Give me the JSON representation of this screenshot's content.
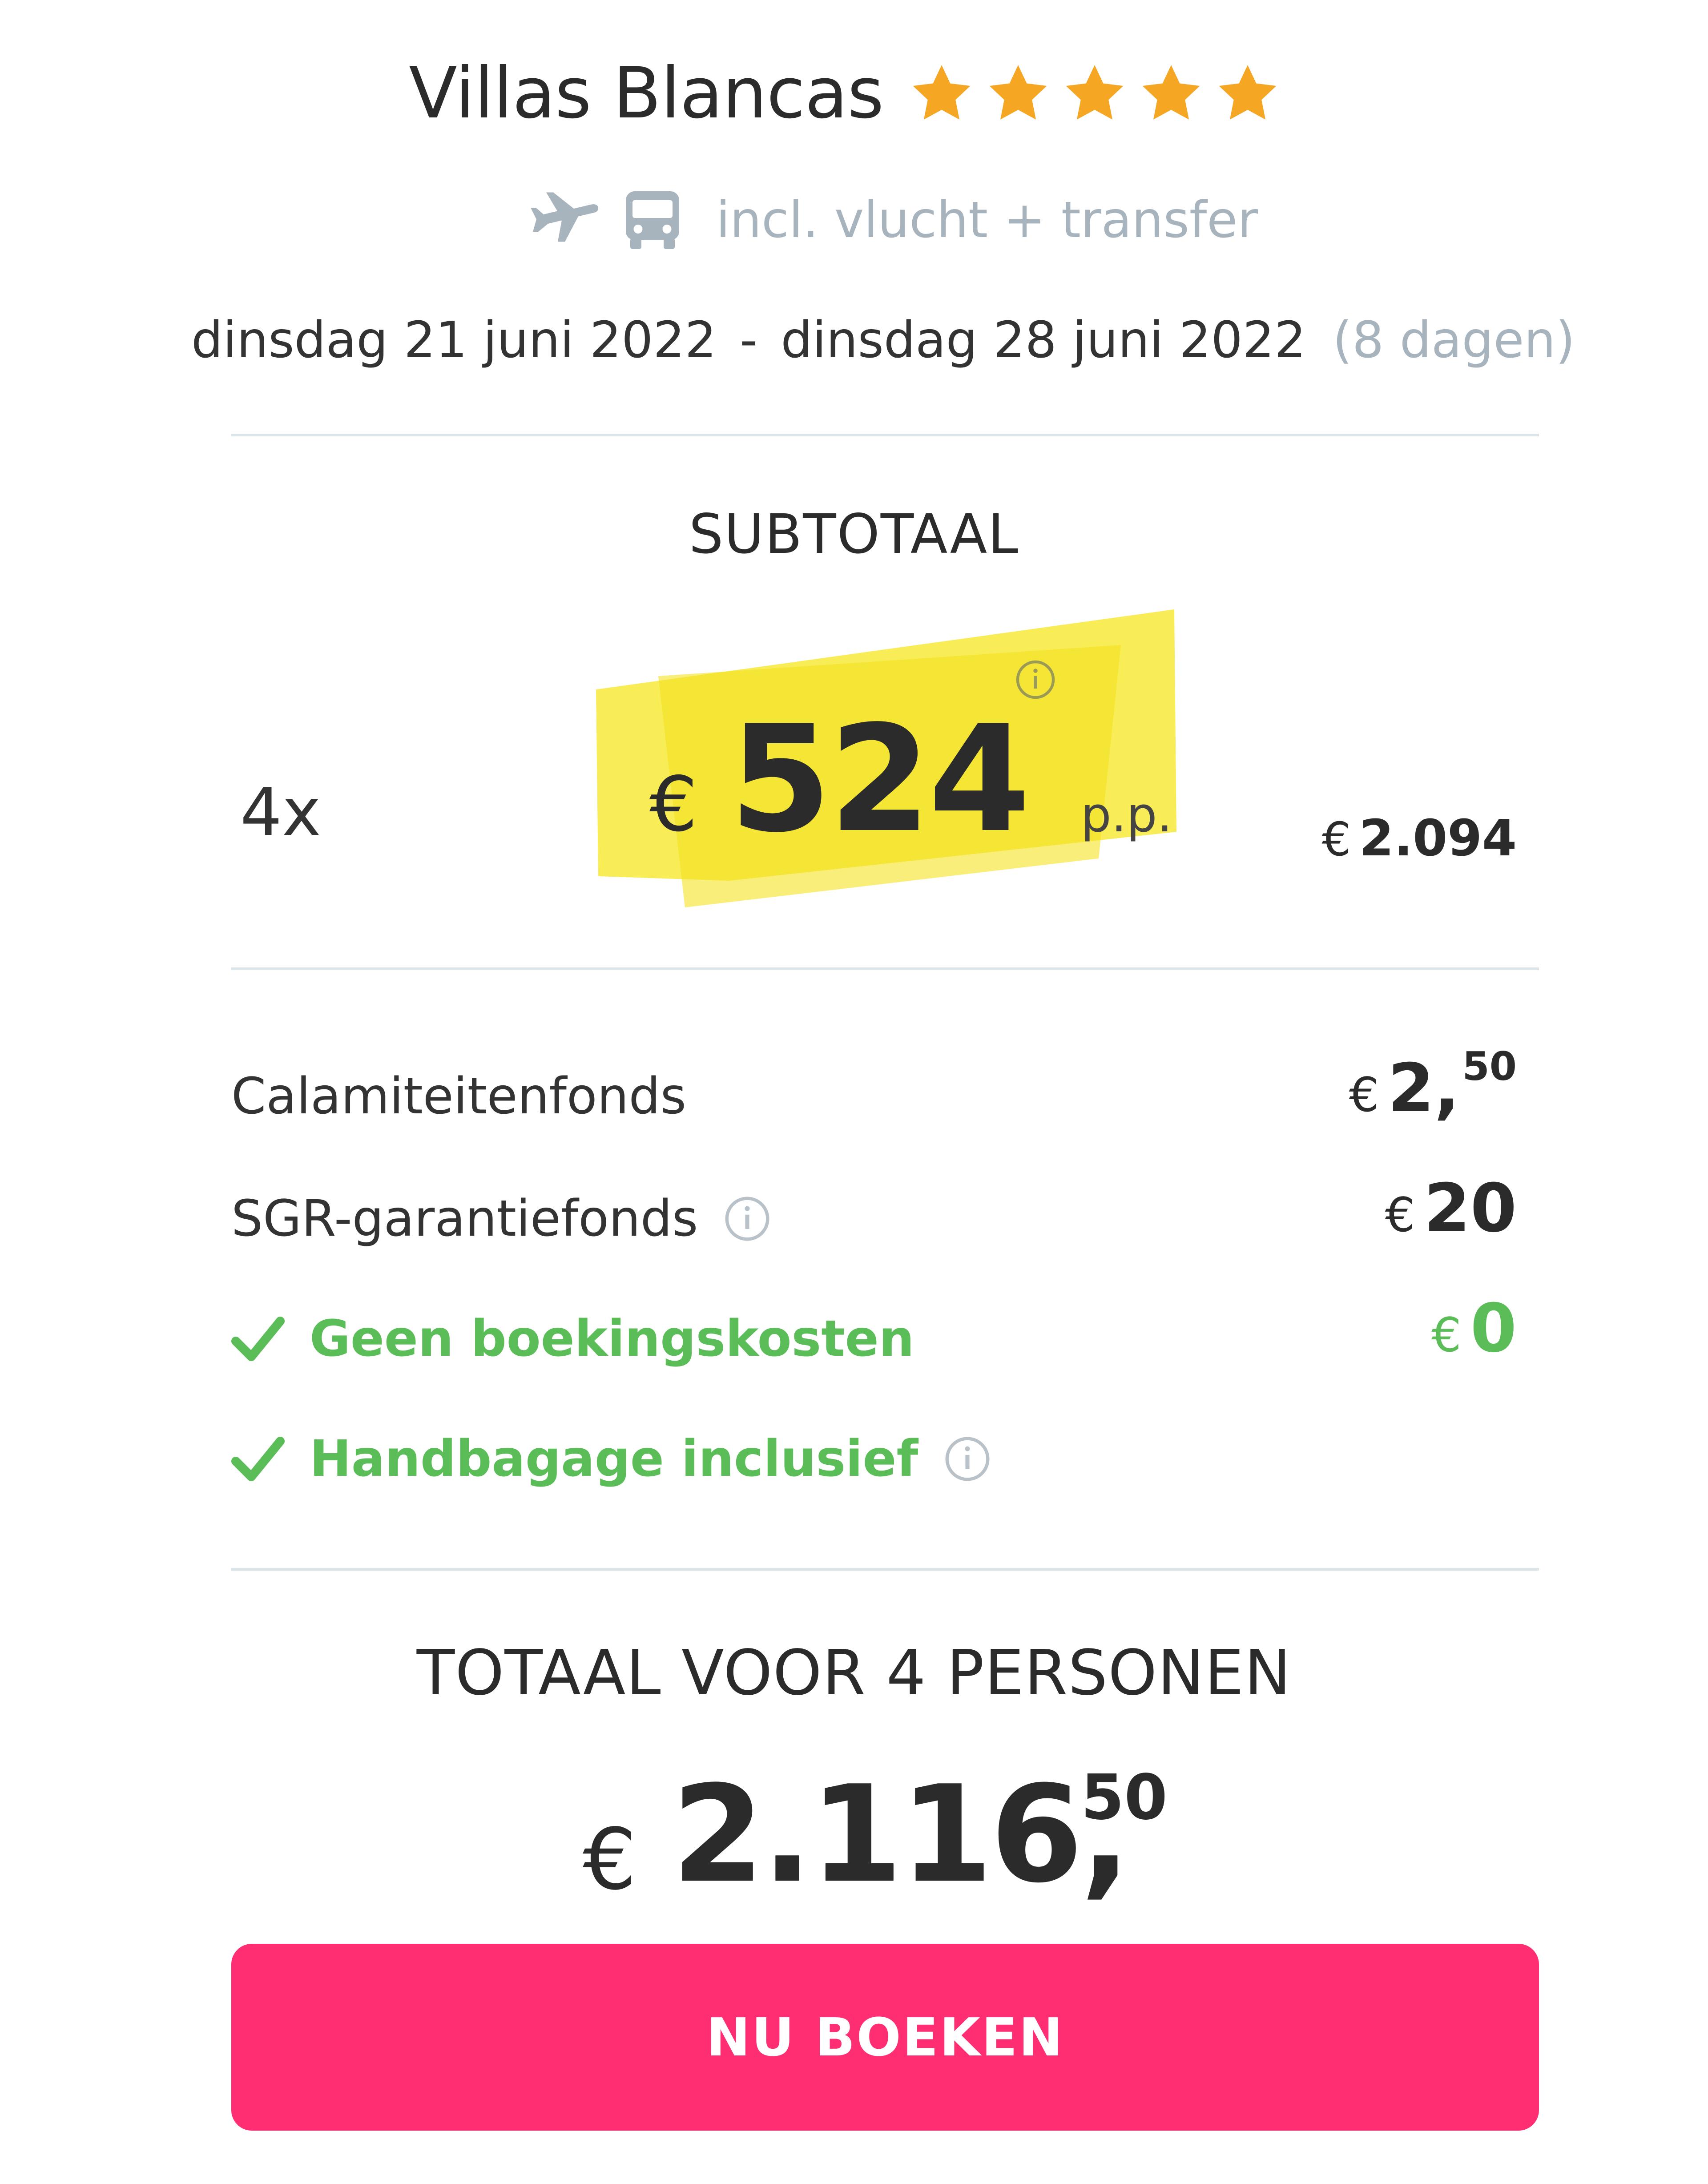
{
  "hotel": {
    "name": "Villas Blancas",
    "star_rating": 5,
    "star_color": "#f5a623"
  },
  "includes": {
    "icons": [
      "plane-icon",
      "bus-icon"
    ],
    "text": "incl. vlucht + transfer"
  },
  "dates": {
    "start": "dinsdag 21 juni 2022",
    "separator": "-",
    "end": "dinsdag 28 juni 2022",
    "duration": "(8 dagen)"
  },
  "subtotal": {
    "label": "SUBTOTAAL",
    "quantity": "4x",
    "currency": "€",
    "price_per_person": "524",
    "per_person_suffix": "p.p.",
    "total": "2.094",
    "highlight_color": "#f7e93a"
  },
  "cost_lines": [
    {
      "label": "Calamiteitenfonds",
      "currency": "€",
      "amount": "2,",
      "decimals": "50"
    },
    {
      "label": "SGR-garantiefonds",
      "currency": "€",
      "amount": "20",
      "info": true
    },
    {
      "label": "Geen boekingskosten",
      "currency": "€",
      "amount": "0",
      "included": true
    },
    {
      "label": "Handbagage inclusief",
      "included": true,
      "info": true
    }
  ],
  "total": {
    "label": "TOTAAL VOOR 4 PERSONEN",
    "currency": "€",
    "amount": "2.116,",
    "decimals": "50"
  },
  "book_button": {
    "label": "NU BOEKEN",
    "color": "#ff2e73"
  },
  "colors": {
    "green": "#5bbd58",
    "muted": "#a7b3bd"
  }
}
